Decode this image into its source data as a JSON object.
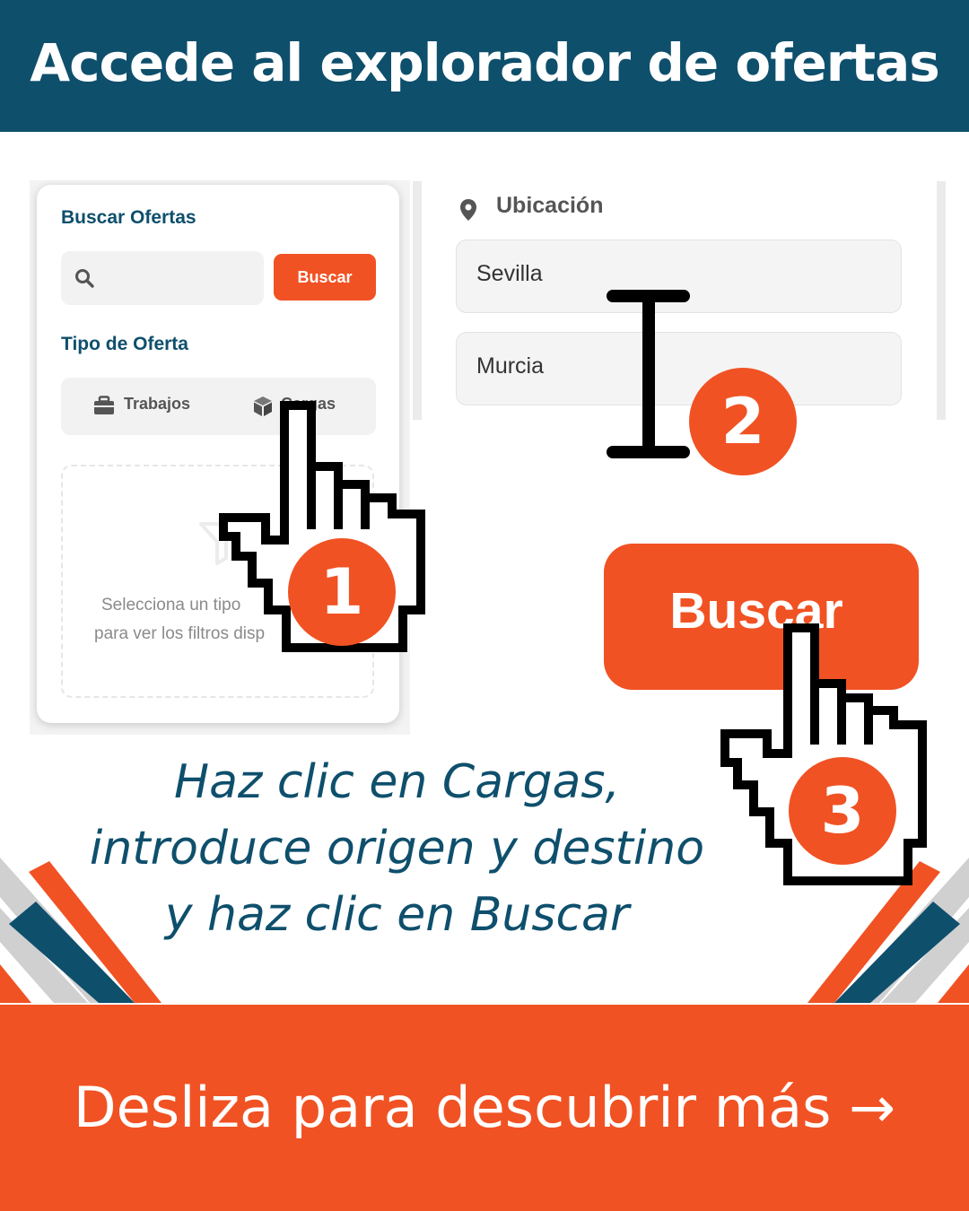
{
  "header": {
    "title": "Accede al explorador de ofertas"
  },
  "search_panel": {
    "heading": "Buscar Ofertas",
    "search_placeholder": "",
    "search_button": "Buscar",
    "type_heading": "Tipo de Oferta",
    "type_options": [
      {
        "label": "Trabajos",
        "icon": "briefcase-icon"
      },
      {
        "label": "Cargas",
        "icon": "box-icon"
      }
    ],
    "hint_line1": "Selecciona un tipo",
    "hint_line2": "para ver los filtros disp"
  },
  "location_panel": {
    "label": "Ubicación",
    "icon": "location-pin-icon",
    "origin": "Sevilla",
    "destination": "Murcia"
  },
  "big_search_button": {
    "label": "Buscar"
  },
  "steps": [
    "1",
    "2",
    "3"
  ],
  "instructions": [
    "Haz clic en Cargas,",
    "introduce origen y destino",
    "y haz clic en Buscar"
  ],
  "footer": {
    "text": "Desliza para descubrir más →"
  },
  "colors": {
    "primary": "#0e4f6c",
    "accent": "#f15223",
    "stripe": "#d0d0d0"
  }
}
